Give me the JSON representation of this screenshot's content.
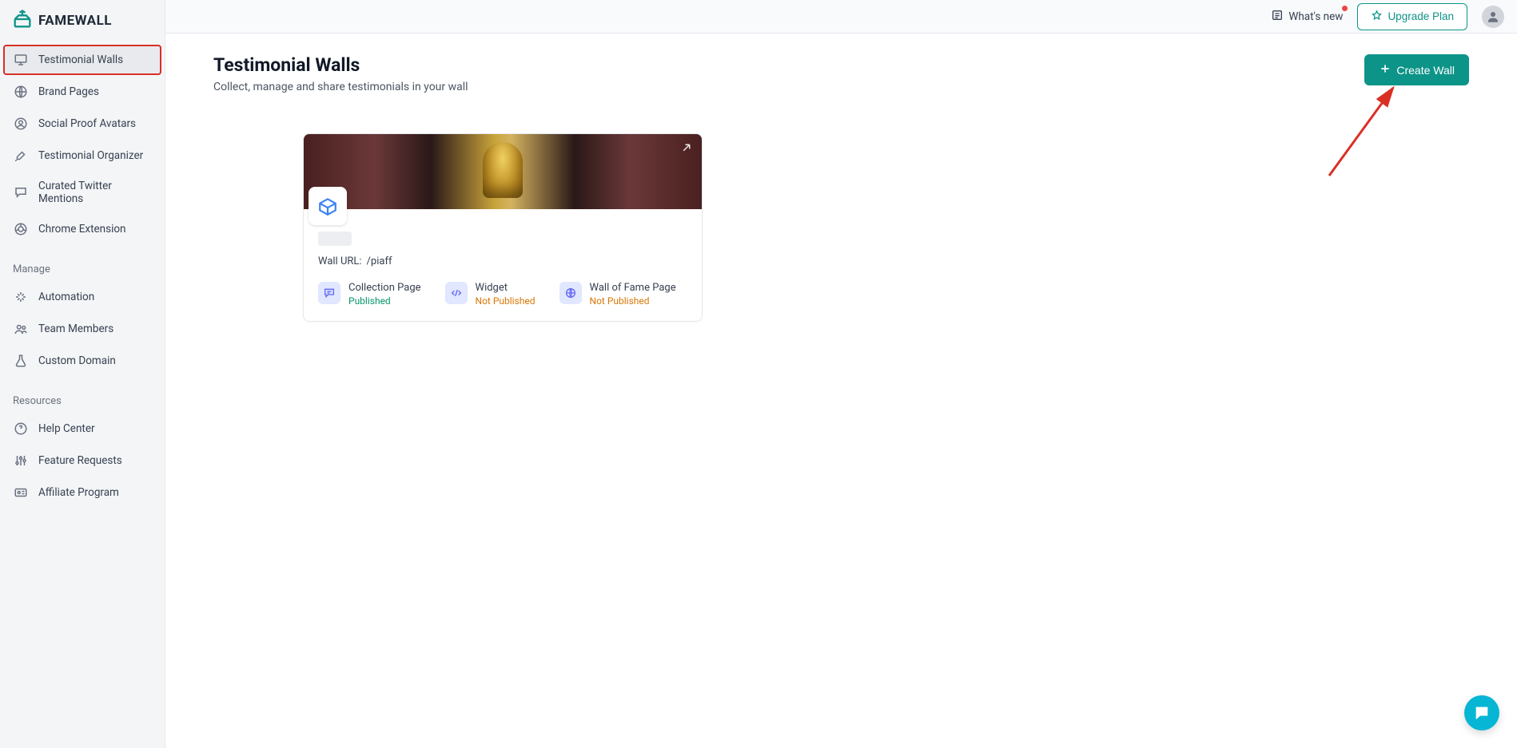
{
  "brand": "FAMEWALL",
  "topbar": {
    "whatsnew": "What's new",
    "upgrade": "Upgrade Plan"
  },
  "sidebar": {
    "main": [
      {
        "label": "Testimonial Walls",
        "icon": "presentation"
      },
      {
        "label": "Brand Pages",
        "icon": "globe"
      },
      {
        "label": "Social Proof Avatars",
        "icon": "user-circle"
      },
      {
        "label": "Testimonial Organizer",
        "icon": "tools"
      },
      {
        "label": "Curated Twitter Mentions",
        "icon": "chat"
      },
      {
        "label": "Chrome Extension",
        "icon": "chrome"
      }
    ],
    "manage_label": "Manage",
    "manage": [
      {
        "label": "Automation",
        "icon": "sparkle"
      },
      {
        "label": "Team Members",
        "icon": "users"
      },
      {
        "label": "Custom Domain",
        "icon": "flask"
      }
    ],
    "resources_label": "Resources",
    "resources": [
      {
        "label": "Help Center",
        "icon": "help"
      },
      {
        "label": "Feature Requests",
        "icon": "sliders"
      },
      {
        "label": "Affiliate Program",
        "icon": "card"
      }
    ]
  },
  "page": {
    "title": "Testimonial Walls",
    "subtitle": "Collect, manage and share testimonials in your wall",
    "create_button": "Create Wall"
  },
  "wall": {
    "url_label": "Wall URL:",
    "url_value": "/piaff",
    "stats": [
      {
        "label": "Collection Page",
        "status": "Published",
        "published": true,
        "icon": "message"
      },
      {
        "label": "Widget",
        "status": "Not Published",
        "published": false,
        "icon": "code"
      },
      {
        "label": "Wall of Fame Page",
        "status": "Not Published",
        "published": false,
        "icon": "globe"
      }
    ]
  }
}
